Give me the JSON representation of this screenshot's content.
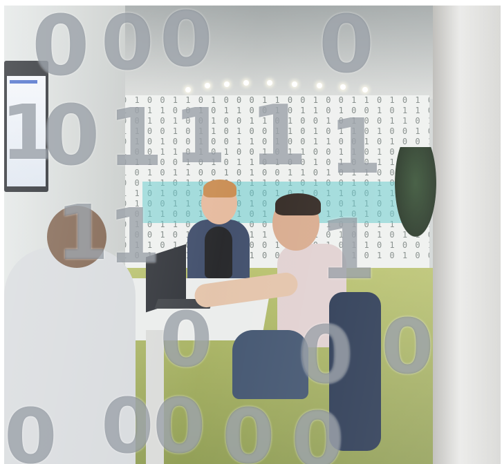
{
  "photo": {
    "subject": "",
    "palette": {
      "back_wall": "#eef0ee",
      "accent_teal": "#59c6c8",
      "floor": "#a7b25c",
      "shirt_pink": "#e0cfcf",
      "jacket_grey": "#d6d9dc",
      "hoodie_navy": "#2f3c5a"
    }
  }
}
